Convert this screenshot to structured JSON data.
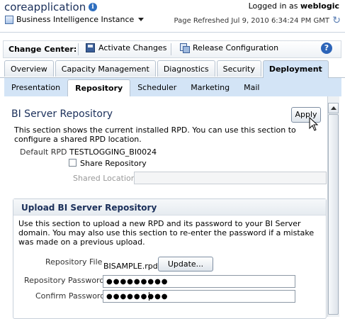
{
  "header": {
    "app_title": "coreapplication",
    "logged_in_prefix": "Logged in as",
    "user": "weblogic",
    "instance_label": "Business Intelligence Instance",
    "refreshed": "Page Refreshed Jul 9, 2010 6:34:24 PM GMT"
  },
  "change_center": {
    "label": "Change Center:",
    "activate": "Activate Changes",
    "release": "Release Configuration",
    "help": "?"
  },
  "main_tabs": [
    "Overview",
    "Capacity Management",
    "Diagnostics",
    "Security",
    "Deployment"
  ],
  "active_main_tab": "Deployment",
  "sub_tabs": [
    "Presentation",
    "Repository",
    "Scheduler",
    "Marketing",
    "Mail"
  ],
  "active_sub_tab": "Repository",
  "repository_section": {
    "title": "BI Server Repository",
    "apply": "Apply",
    "description": "This section shows the current installed RPD. You can use this section to configure a shared RPD location.",
    "default_rpd_label": "Default RPD",
    "default_rpd_value": "TESTLOGGING_BI0024",
    "share_label": "Share Repository",
    "share_checked": false,
    "shared_location_label": "Shared Location",
    "shared_location_value": ""
  },
  "upload_section": {
    "title": "Upload BI Server Repository",
    "description": "Use this section to upload a new RPD and its password to your BI Server domain. You may also use this section to re-enter the password if a mistake was made on a previous upload.",
    "file_label": "Repository File",
    "file_value": "BISAMPLE.rpd",
    "update": "Update...",
    "password_label": "Repository Password",
    "password_mask": "●●●●●●●●●",
    "confirm_label": "Confirm Password",
    "confirm_mask": "●●●●●●●●●"
  },
  "colors": {
    "title_blue": "#1a2f5a",
    "tab_active_bg": "#d3e4f6",
    "help_blue": "#2c64b8"
  }
}
